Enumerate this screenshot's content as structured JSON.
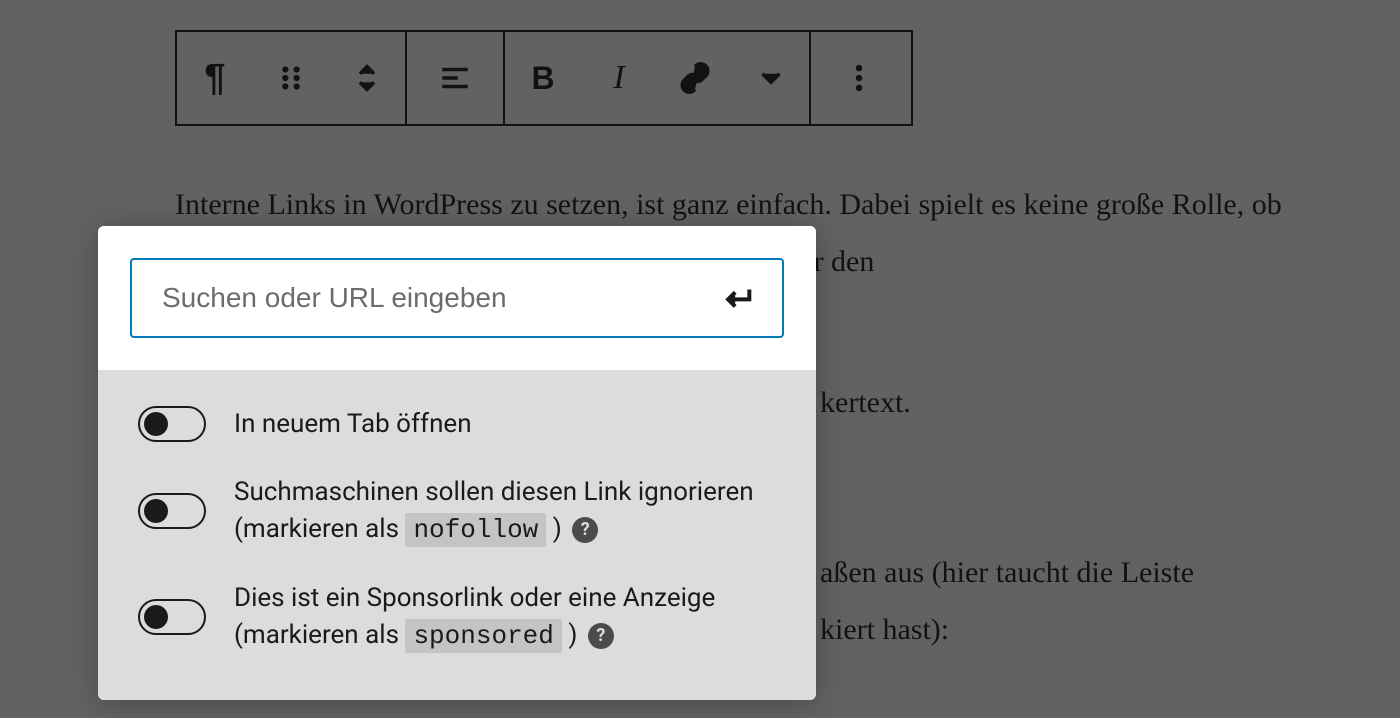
{
  "toolbar": {
    "paragraph_icon": "¶",
    "bold_label": "B",
    "italic_label": "I"
  },
  "paragraph1": "Interne Links in WordPress zu setzen, ist ganz einfach. Dabei spielt es keine große Rolle, ob du den klassischen WordPress Editor verwendest oder den",
  "bg_frag1": "kertext.",
  "bg_frag2": "aßen aus (hier taucht die Leiste",
  "bg_frag3": "kiert hast):",
  "link_popover": {
    "placeholder": "Suchen oder URL eingeben",
    "settings": {
      "new_tab": {
        "label": "In neuem Tab öffnen"
      },
      "nofollow": {
        "prefix": "Suchmaschinen sollen diesen Link ignorieren (markieren als",
        "code": "nofollow",
        "suffix": ")"
      },
      "sponsored": {
        "prefix": "Dies ist ein Sponsorlink oder eine Anzeige (markieren als",
        "code": "sponsored",
        "suffix": ")"
      }
    }
  }
}
